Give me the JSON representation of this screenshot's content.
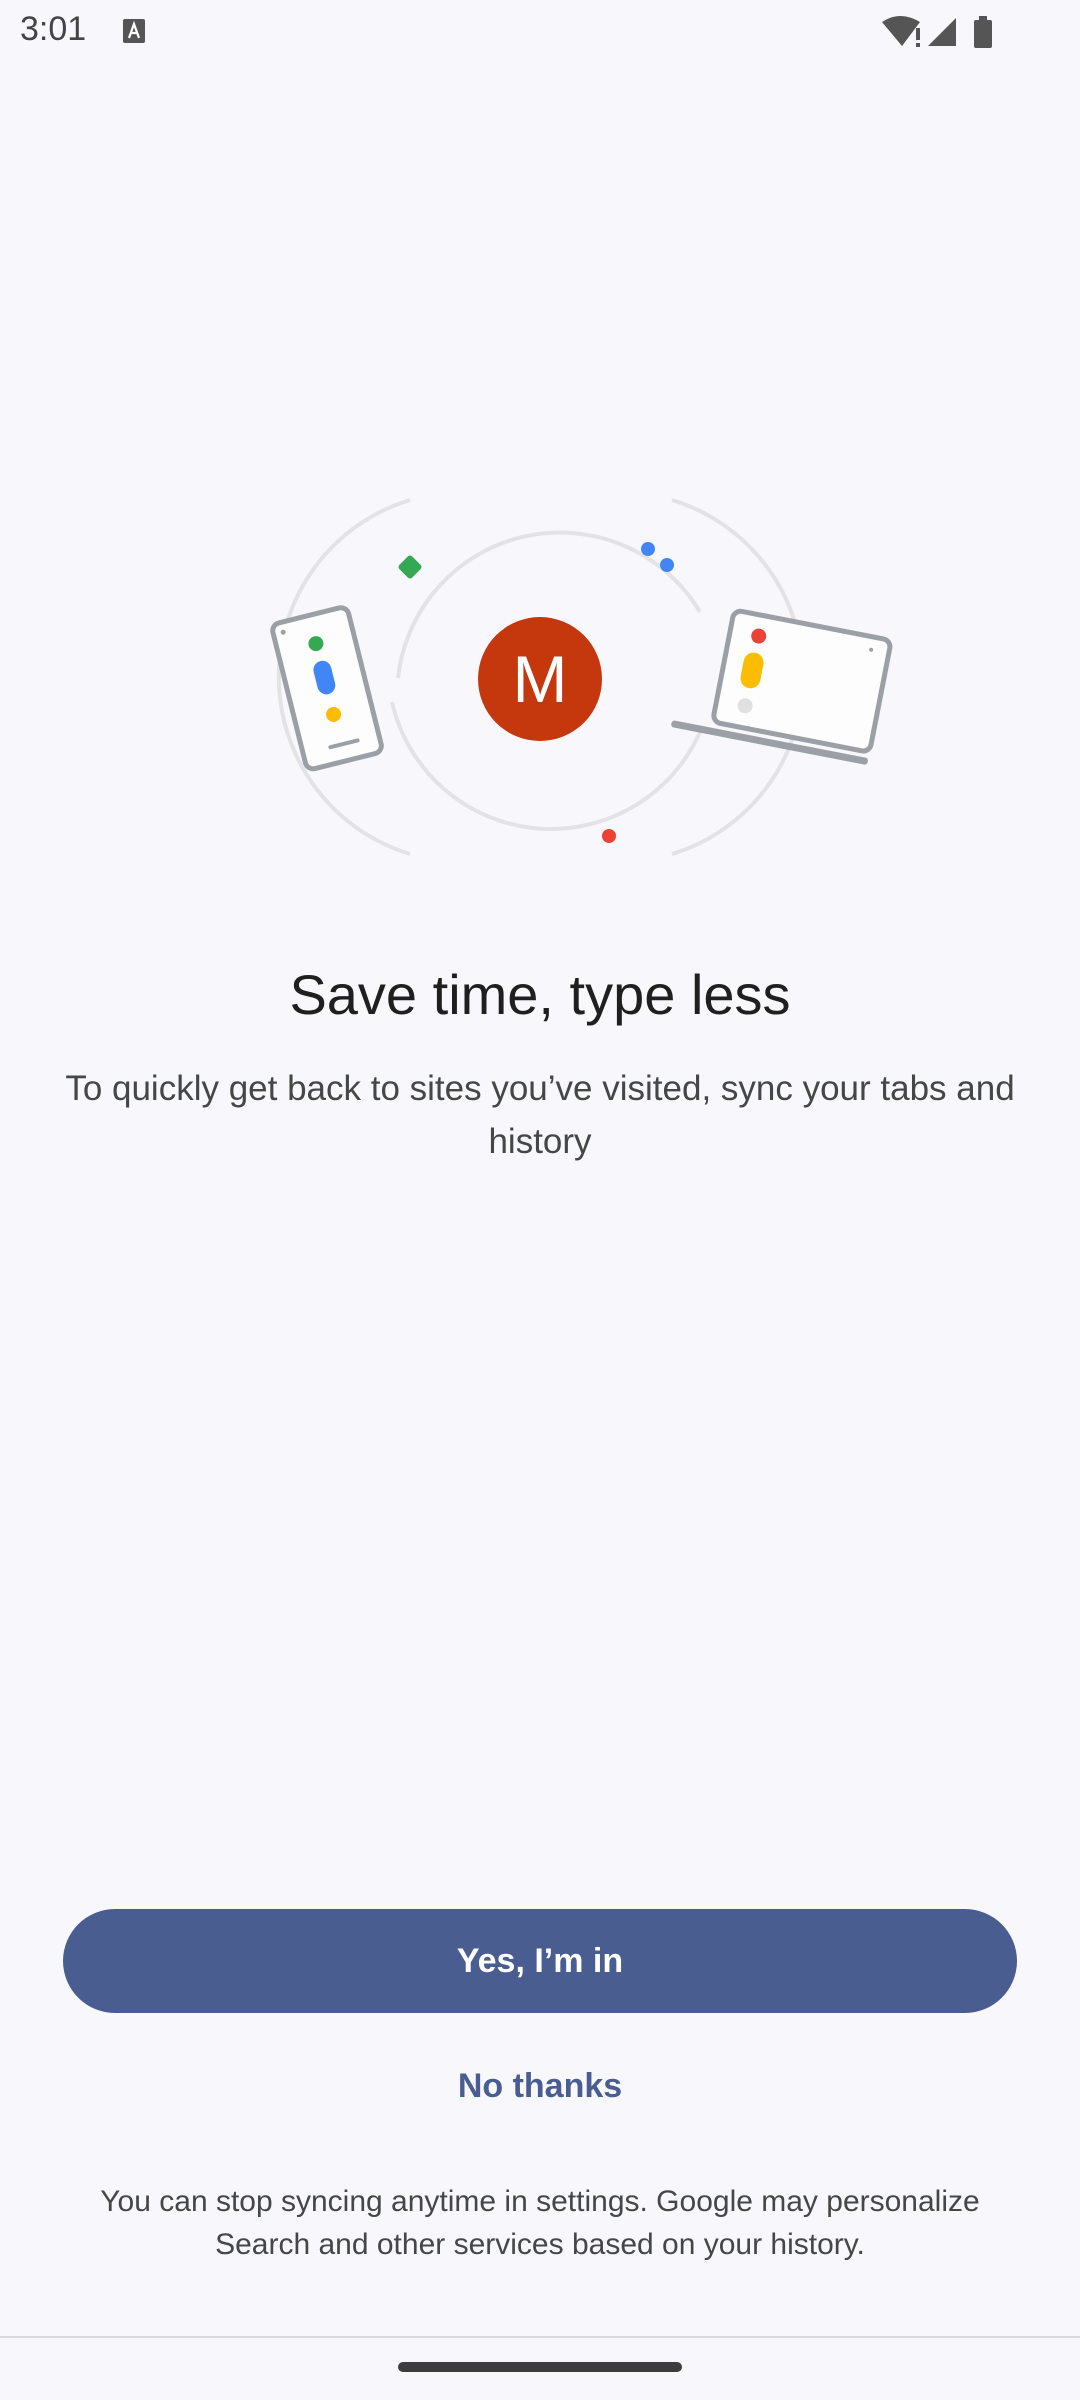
{
  "status_bar": {
    "time": "3:01",
    "icons": [
      "font-a-icon",
      "wifi-alert-icon",
      "cell-signal-icon",
      "battery-icon"
    ]
  },
  "illustration": {
    "avatar_letter": "M",
    "colors": {
      "avatar": "#c5380d",
      "green": "#34a853",
      "blue": "#4285f4",
      "yellow": "#fbbc04",
      "red": "#ea4335",
      "device_outline": "#9aa0a6"
    }
  },
  "content": {
    "title": "Save time, type less",
    "subtitle": "To quickly get back to sites you’ve visited, sync your tabs and history"
  },
  "actions": {
    "accept_label": "Yes, I’m in",
    "decline_label": "No thanks"
  },
  "footer": {
    "note": "You can stop syncing anytime in settings. Google may personalize Search and other services based on your history."
  },
  "colors": {
    "background": "#f8f7fc",
    "primary": "#4a5d91",
    "text": "#1f1f1f",
    "secondary_text": "#444746"
  }
}
